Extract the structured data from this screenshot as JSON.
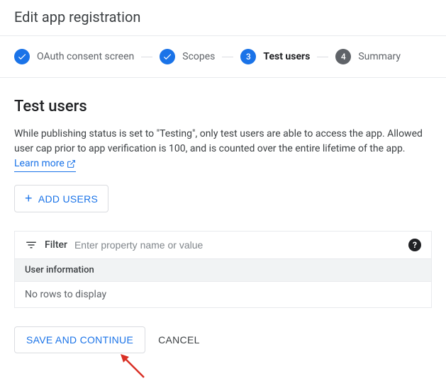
{
  "header": {
    "title": "Edit app registration"
  },
  "stepper": {
    "steps": [
      {
        "label": "OAuth consent screen",
        "state": "done"
      },
      {
        "label": "Scopes",
        "state": "done"
      },
      {
        "label": "Test users",
        "state": "active",
        "number": "3"
      },
      {
        "label": "Summary",
        "state": "future",
        "number": "4"
      }
    ]
  },
  "section": {
    "title": "Test users",
    "description_pre": "While publishing status is set to \"Testing\", only test users are able to access the app. Allowed user cap prior to app verification is 100, and is counted over the entire lifetime of the app. ",
    "learn_more": "Learn more"
  },
  "buttons": {
    "add_users": "ADD USERS",
    "save": "SAVE AND CONTINUE",
    "cancel": "CANCEL"
  },
  "filter": {
    "label": "Filter",
    "placeholder": "Enter property name or value"
  },
  "table": {
    "header": "User information",
    "empty": "No rows to display"
  }
}
